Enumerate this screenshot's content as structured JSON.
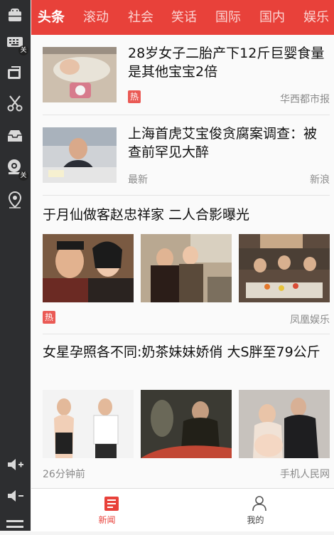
{
  "sidebar": {
    "icons": [
      {
        "name": "android-icon"
      },
      {
        "name": "keyboard-icon",
        "badge": "关"
      },
      {
        "name": "screen-rotate-icon"
      },
      {
        "name": "scissors-icon"
      },
      {
        "name": "inbox-icon"
      },
      {
        "name": "location-eye-icon",
        "badge": "关"
      },
      {
        "name": "map-pin-icon"
      },
      {
        "name": "volume-up-icon"
      },
      {
        "name": "volume-down-icon"
      },
      {
        "name": "menu-icon"
      }
    ]
  },
  "tabs": [
    "头条",
    "滚动",
    "社会",
    "笑话",
    "国际",
    "国内",
    "娱乐"
  ],
  "feed": [
    {
      "title": "28岁女子二胎产下12斤巨婴食量是其他宝宝2倍",
      "badge": "热",
      "source": "华西都市报"
    },
    {
      "title": "上海首虎艾宝俊贪腐案调查：被查前罕见大醉",
      "time": "最新",
      "source": "新浪"
    },
    {
      "title": "于月仙做客赵忠祥家 二人合影曝光",
      "badge": "热",
      "source": "凤凰娱乐"
    },
    {
      "title": "女星孕照各不同:奶茶妹妹娇俏 大S胖至79公斤",
      "time": "26分钟前",
      "source": "手机人民网"
    }
  ],
  "bottom_nav": [
    {
      "label": "新闻",
      "active": true
    },
    {
      "label": "我的",
      "active": false
    }
  ],
  "colors": {
    "accent": "#e8413a",
    "hot": "#ea5a55"
  }
}
